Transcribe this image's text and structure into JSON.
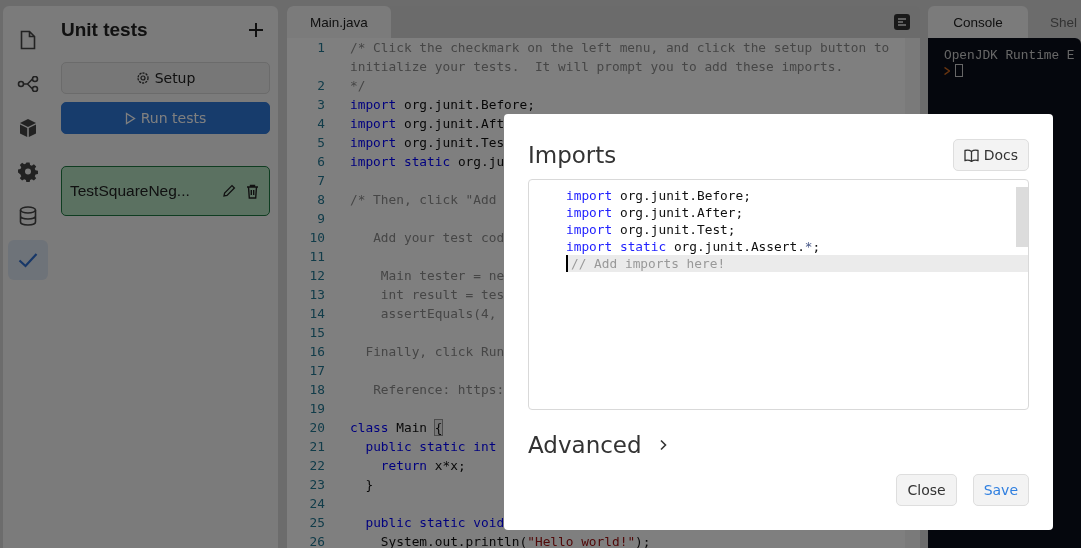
{
  "rail": {
    "items": [
      {
        "kind": "file",
        "selected": false
      },
      {
        "kind": "share",
        "selected": false
      },
      {
        "kind": "cube",
        "selected": false
      },
      {
        "kind": "gear",
        "selected": false
      },
      {
        "kind": "database",
        "selected": false
      },
      {
        "kind": "check",
        "selected": true
      }
    ]
  },
  "unit_tests": {
    "title": "Unit tests",
    "setup_button": "Setup",
    "run_button": "Run tests",
    "tests": [
      {
        "name": "TestSquareNeg..."
      }
    ]
  },
  "editor": {
    "tabs": [
      {
        "label": "Main.java",
        "selected": true
      }
    ],
    "lines": [
      {
        "num": "1",
        "tokens": [
          {
            "t": "/* Click the checkmark on the left menu, and click the setup button to initialize your tests.  It will prompt you to add these imports.",
            "kind": "comment"
          }
        ]
      },
      {
        "num": "2",
        "tokens": [
          {
            "t": "*/",
            "kind": "comment"
          }
        ]
      },
      {
        "num": "3",
        "tokens": [
          {
            "t": "import",
            "kind": "keyword"
          },
          {
            "t": " org.junit.Before;",
            "kind": "plain"
          }
        ]
      },
      {
        "num": "4",
        "tokens": [
          {
            "t": "import",
            "kind": "keyword"
          },
          {
            "t": " org.junit.Aft",
            "kind": "plain"
          }
        ]
      },
      {
        "num": "5",
        "tokens": [
          {
            "t": "import",
            "kind": "keyword"
          },
          {
            "t": " org.junit.Tes",
            "kind": "plain"
          }
        ]
      },
      {
        "num": "6",
        "tokens": [
          {
            "t": "import static",
            "kind": "keyword"
          },
          {
            "t": " org.ju",
            "kind": "plain"
          }
        ]
      },
      {
        "num": "7"
      },
      {
        "num": "8",
        "tokens": [
          {
            "t": "/* Then, click \"Add",
            "kind": "comment"
          }
        ]
      },
      {
        "num": "9"
      },
      {
        "num": "10",
        "tokens": [
          {
            "t": "   Add your test cod",
            "kind": "comment"
          }
        ]
      },
      {
        "num": "11"
      },
      {
        "num": "12",
        "tokens": [
          {
            "t": "    Main tester = ne",
            "kind": "comment"
          }
        ]
      },
      {
        "num": "13",
        "tokens": [
          {
            "t": "    int result = tes",
            "kind": "comment"
          }
        ]
      },
      {
        "num": "14",
        "tokens": [
          {
            "t": "    assertEquals(4,",
            "kind": "comment"
          }
        ]
      },
      {
        "num": "15"
      },
      {
        "num": "16",
        "tokens": [
          {
            "t": "  Finally, click Run",
            "kind": "comment"
          }
        ]
      },
      {
        "num": "17"
      },
      {
        "num": "18",
        "tokens": [
          {
            "t": "   Reference: https:",
            "kind": "comment"
          }
        ]
      },
      {
        "num": "19"
      },
      {
        "num": "20",
        "tokens": [
          {
            "t": "class",
            "kind": "keyword"
          },
          {
            "t": " Main ",
            "kind": "plain"
          },
          {
            "t": "{",
            "kind": "bracket"
          }
        ]
      },
      {
        "num": "21",
        "tokens": [
          {
            "t": "  public static int",
            "kind": "keyword"
          }
        ]
      },
      {
        "num": "22",
        "tokens": [
          {
            "t": "    return",
            "kind": "keyword"
          },
          {
            "t": " x*x;",
            "kind": "plain"
          }
        ]
      },
      {
        "num": "23",
        "tokens": [
          {
            "t": "  }",
            "kind": "plain"
          }
        ]
      },
      {
        "num": "24"
      },
      {
        "num": "25",
        "tokens": [
          {
            "t": "  public static void",
            "kind": "keyword"
          }
        ]
      },
      {
        "num": "26",
        "tokens": [
          {
            "t": "    System.out.println(",
            "kind": "plain"
          },
          {
            "t": "\"Hello world!\"",
            "kind": "string"
          },
          {
            "t": ");",
            "kind": "plain"
          }
        ]
      }
    ]
  },
  "console": {
    "tabs": [
      {
        "label": "Console",
        "selected": true
      },
      {
        "label": "Shel",
        "selected": false
      }
    ],
    "output": "OpenJDK Runtime E"
  },
  "modal": {
    "title": "Imports",
    "docs_button": "Docs",
    "lines": [
      {
        "tokens": [
          {
            "t": "import",
            "kind": "keyword"
          },
          {
            "t": " org.junit.Before;",
            "kind": "plain"
          }
        ]
      },
      {
        "tokens": [
          {
            "t": "import",
            "kind": "keyword"
          },
          {
            "t": " org.junit.After;",
            "kind": "plain"
          }
        ]
      },
      {
        "tokens": [
          {
            "t": "import",
            "kind": "keyword"
          },
          {
            "t": " org.junit.Test;",
            "kind": "plain"
          }
        ]
      },
      {
        "tokens": [
          {
            "t": "import static",
            "kind": "keyword"
          },
          {
            "t": " org.junit.Assert.",
            "kind": "plain"
          },
          {
            "t": "*",
            "kind": "operator"
          },
          {
            "t": ";",
            "kind": "plain"
          }
        ]
      }
    ],
    "placeholder": "// Add imports here!",
    "advanced": {
      "label": "Advanced",
      "expanded": false
    },
    "buttons": [
      {
        "label": "Close",
        "kind": "secondary"
      },
      {
        "label": "Save",
        "kind": "primary"
      }
    ]
  }
}
